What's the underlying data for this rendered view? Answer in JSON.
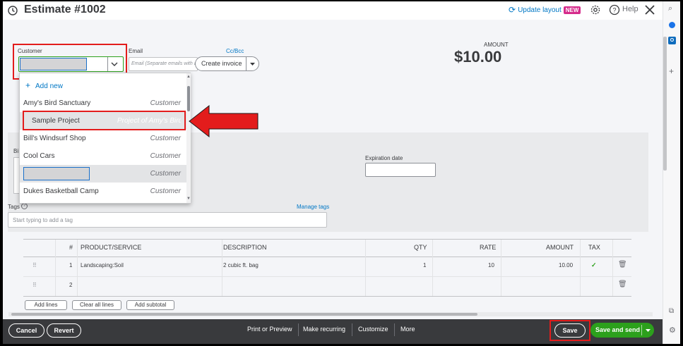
{
  "header": {
    "title": "Estimate #1002",
    "update_layout": "Update layout",
    "new_badge": "NEW",
    "help": "Help"
  },
  "customer": {
    "label": "Customer",
    "value": ""
  },
  "email": {
    "label": "Email",
    "placeholder": "Email (Separate emails with a comma)",
    "cc_bcc": "Cc/Bcc"
  },
  "create_invoice": "Create invoice",
  "amount": {
    "label": "AMOUNT",
    "value": "$10.00"
  },
  "dropdown": {
    "add_new": "Add new",
    "items": [
      {
        "name": "Amy's Bird Sanctuary",
        "type": "Customer"
      },
      {
        "name": "Sample Project",
        "type": "Project of Amy's Bird..."
      },
      {
        "name": "Bill's Windsurf Shop",
        "type": "Customer"
      },
      {
        "name": "Cool Cars",
        "type": "Customer"
      },
      {
        "name": "",
        "type": "Customer"
      },
      {
        "name": "Dukes Basketball Camp",
        "type": "Customer"
      }
    ]
  },
  "billing_prefix": "Bi",
  "expiration": {
    "label": "Expiration date",
    "value": ""
  },
  "tags": {
    "label": "Tags",
    "manage": "Manage tags",
    "placeholder": "Start typing to add a tag"
  },
  "table": {
    "headers": [
      "#",
      "PRODUCT/SERVICE",
      "DESCRIPTION",
      "QTY",
      "RATE",
      "AMOUNT",
      "TAX"
    ],
    "rows": [
      {
        "num": "1",
        "product": "Landscaping:Soil",
        "description": "2 cubic ft. bag",
        "qty": "1",
        "rate": "10",
        "amount": "10.00",
        "tax": "✓"
      },
      {
        "num": "2",
        "product": "",
        "description": "",
        "qty": "",
        "rate": "",
        "amount": "",
        "tax": ""
      }
    ]
  },
  "line_buttons": {
    "add_lines": "Add lines",
    "clear_all": "Clear all lines",
    "add_subtotal": "Add subtotal"
  },
  "footer": {
    "cancel": "Cancel",
    "revert": "Revert",
    "print": "Print or Preview",
    "recurring": "Make recurring",
    "customize": "Customize",
    "more": "More",
    "save": "Save",
    "save_send": "Save and send"
  },
  "colors": {
    "accent": "#0077c5",
    "highlight": "#e31c1c",
    "green": "#2ca01c",
    "footer": "#393a3d"
  }
}
